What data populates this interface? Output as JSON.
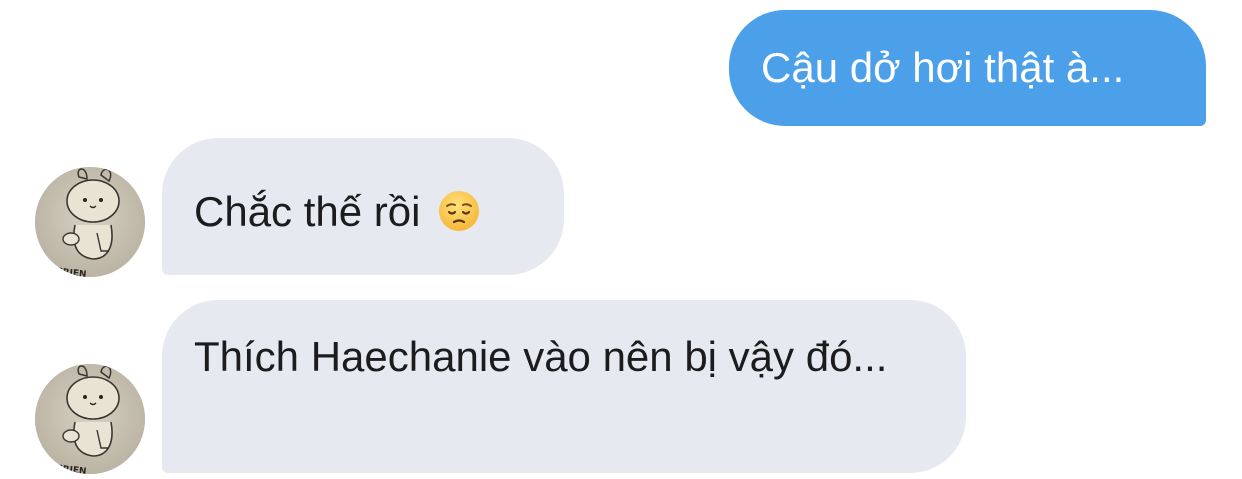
{
  "messages": [
    {
      "direction": "outgoing",
      "text": "Cậu dở hơi thật à..."
    },
    {
      "direction": "incoming",
      "text": "Chắc thế rồi",
      "emoji": "pensive-face-emoji"
    },
    {
      "direction": "incoming",
      "text": "Thích Haechanie vào nên bị vậy đó..."
    }
  ],
  "avatar": {
    "icon": "bunny-character-avatar",
    "badge_text": "E FRIEN"
  },
  "colors": {
    "outgoing_bubble": "#4c9fe9",
    "incoming_bubble": "#e6e9ef",
    "outgoing_text": "#ffffff",
    "incoming_text": "#1c1c1e"
  }
}
